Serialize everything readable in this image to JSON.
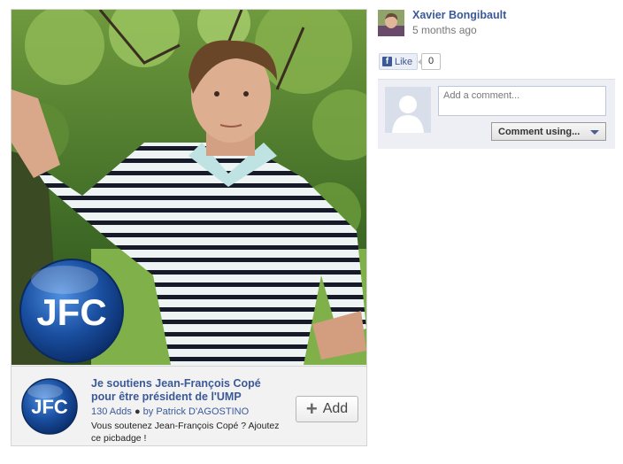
{
  "post": {
    "author_name": "Xavier Bongibault",
    "timestamp": "5 months ago"
  },
  "like": {
    "label": "Like",
    "count": "0",
    "icon": "facebook-f-icon"
  },
  "comment": {
    "placeholder": "Add a comment...",
    "using_label": "Comment using..."
  },
  "badge": {
    "logo_text": "JFC",
    "title": "Je soutiens Jean-François Copé pour être président de l'UMP",
    "adds": "130 Adds",
    "separator": "●",
    "by_prefix": "by",
    "author": "Patrick D'AGOSTINO",
    "description": "Vous soutenez Jean-François Copé ? Ajoutez ce picbadge !",
    "add_button": "Add"
  },
  "colors": {
    "link": "#3b5998",
    "logo_blue": "#1a4fa0"
  }
}
